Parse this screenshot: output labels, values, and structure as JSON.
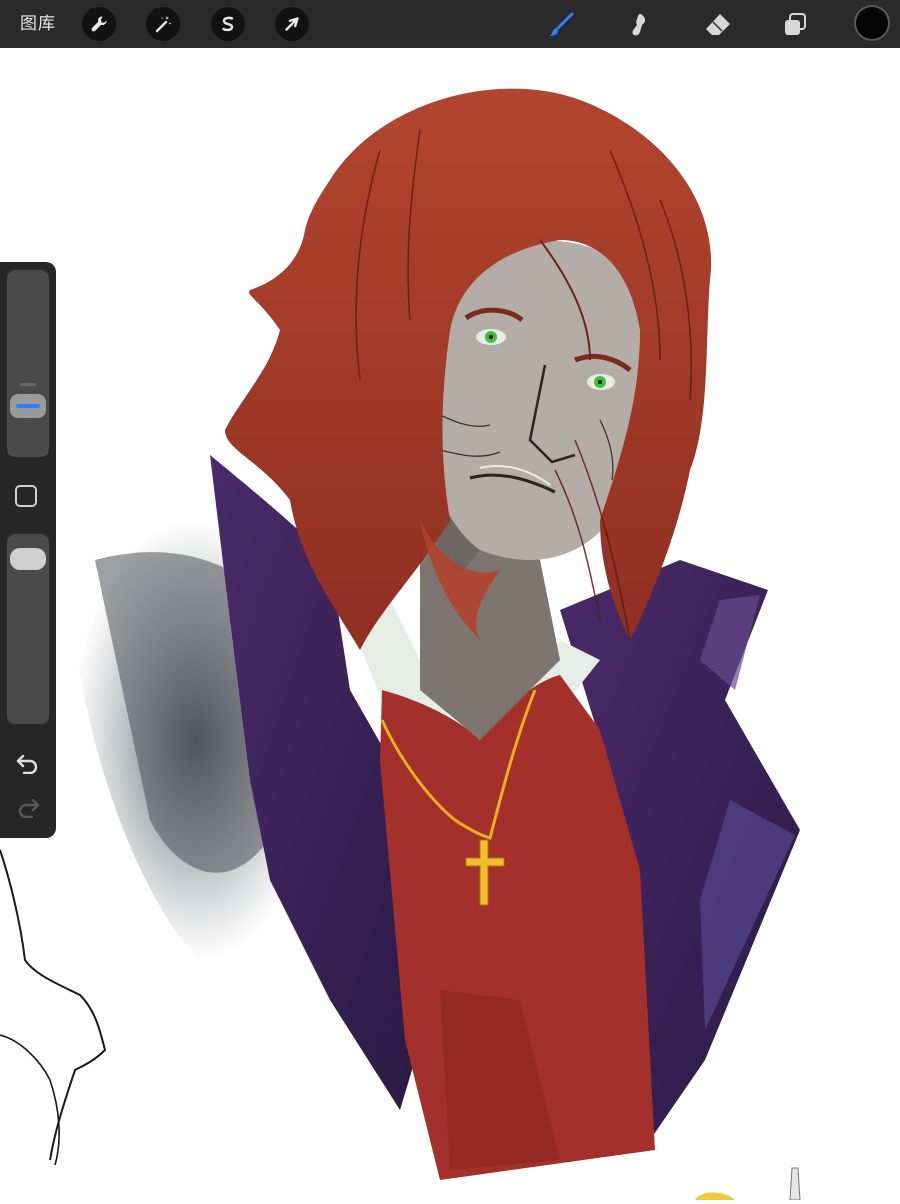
{
  "toolbar": {
    "gallery_label": "图库",
    "left_tools": [
      "wrench-icon",
      "magic-wand-icon",
      "selection-s-icon",
      "transform-arrow-icon"
    ],
    "right_tools": [
      "brush-icon",
      "smudge-icon",
      "eraser-icon",
      "layers-icon"
    ],
    "active_tool": "brush-icon",
    "active_color": "#050505"
  },
  "sidebar": {
    "brush_size_level": 0.22,
    "brush_opacity_level": 0.95,
    "actions": [
      "undo-icon",
      "redo-icon"
    ]
  },
  "colors": {
    "toolbar_bg": "#2a2a2a",
    "accent_blue": "#2d7ff9",
    "canvas_bg": "#ffffff"
  }
}
